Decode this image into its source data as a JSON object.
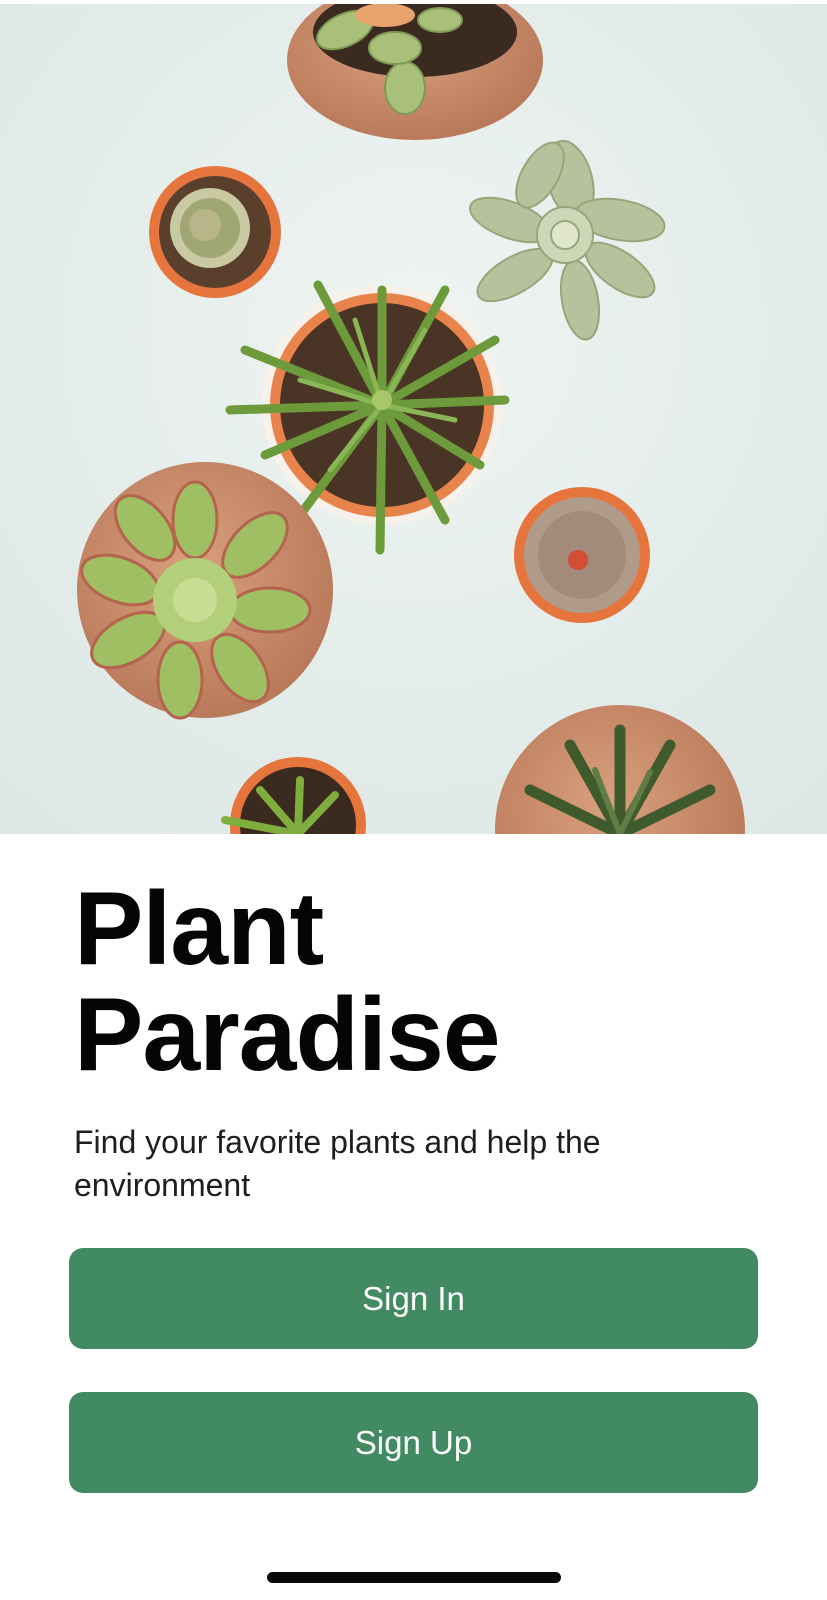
{
  "app": {
    "title_line1": "Plant",
    "title_line2": "Paradise",
    "subtitle": "Find your favorite plants and help the environment"
  },
  "actions": {
    "sign_in_label": "Sign In",
    "sign_up_label": "Sign Up"
  },
  "hero": {
    "description_icon": "succulent-plants-photo-icon"
  },
  "colors": {
    "primary_button": "#428a62",
    "button_text": "#ffffff",
    "title_text": "#050505",
    "hero_background": "#e6eeec"
  }
}
